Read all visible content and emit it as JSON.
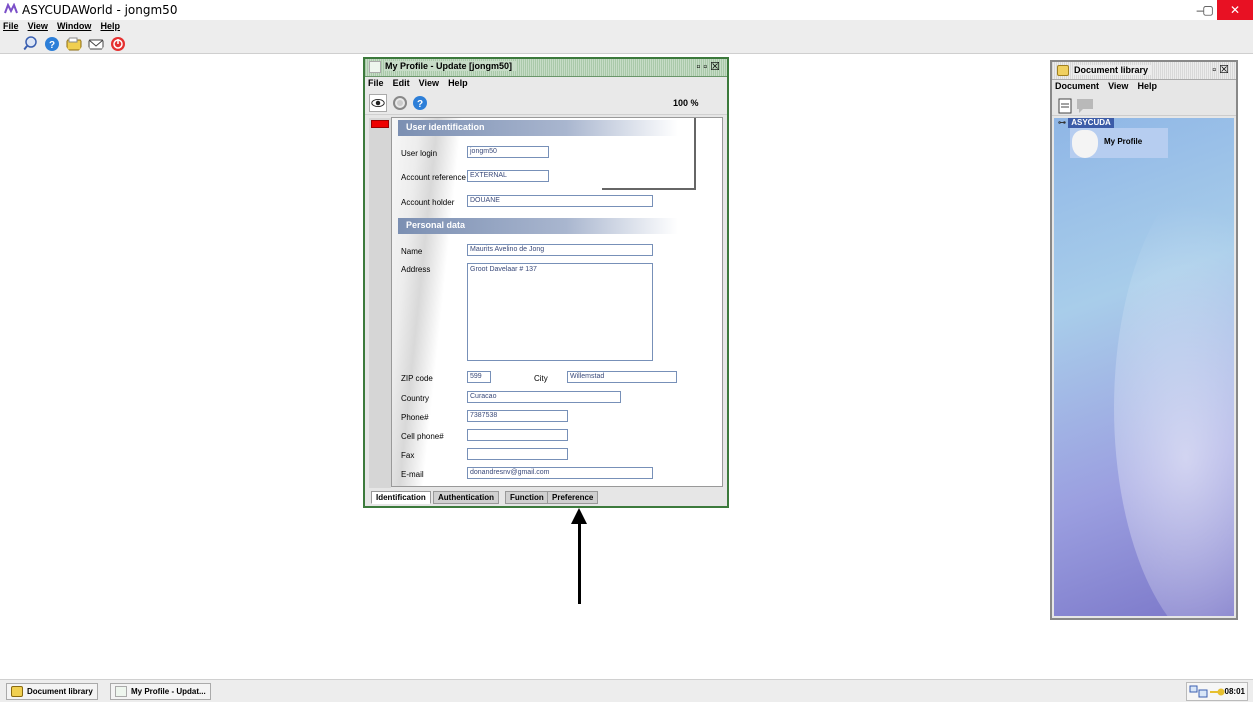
{
  "app": {
    "title": "ASYCUDAWorld - jongm50"
  },
  "window_controls": {
    "minimize": "–",
    "maximize": "▢",
    "close": "✕"
  },
  "menubar": [
    "File",
    "View",
    "Window",
    "Help"
  ],
  "profile_window": {
    "title": "My Profile - Update [jongm50]",
    "menu": [
      "File",
      "Edit",
      "View",
      "Help"
    ],
    "zoom": "100 %",
    "sections": {
      "user_identification": "User identification",
      "personal_data": "Personal data"
    },
    "fields": {
      "user_login": {
        "label": "User login",
        "value": "jongm50"
      },
      "account_reference": {
        "label": "Account reference",
        "value": "EXTERNAL"
      },
      "account_holder": {
        "label": "Account holder",
        "value": "DOUANE"
      },
      "name": {
        "label": "Name",
        "value": "Maurits Avelino de Jong"
      },
      "address": {
        "label": "Address",
        "value": "Groot Davelaar # 137"
      },
      "zip": {
        "label": "ZIP code",
        "value": "599"
      },
      "city": {
        "label": "City",
        "value": "Willemstad"
      },
      "country": {
        "label": "Country",
        "value": "Curacao"
      },
      "phone": {
        "label": "Phone#",
        "value": "7387538"
      },
      "cell": {
        "label": "Cell phone#",
        "value": ""
      },
      "fax": {
        "label": "Fax",
        "value": ""
      },
      "email": {
        "label": "E-mail",
        "value": "donandresnv@gmail.com"
      }
    },
    "tabs": [
      "Identification",
      "Authentication",
      "Function",
      "Preference"
    ],
    "active_tab": "Identification"
  },
  "document_library": {
    "title": "Document library",
    "menu": [
      "Document",
      "View",
      "Help"
    ],
    "tree_root": "ASYCUDA",
    "tile": "My Profile"
  },
  "taskbar": {
    "items": [
      "Document library",
      "My Profile - Updat..."
    ],
    "clock": "08:01"
  },
  "colors": {
    "window_border": "#3c7a3c",
    "section_header": "#7b8fb2",
    "field_border": "#7790b8",
    "close_red": "#e81123"
  }
}
